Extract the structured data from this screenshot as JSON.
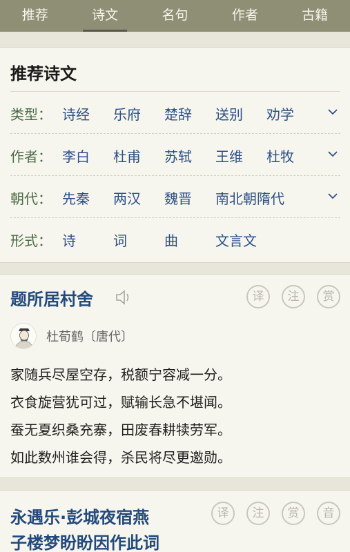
{
  "nav": {
    "tabs": [
      "推荐",
      "诗文",
      "名句",
      "作者",
      "古籍"
    ],
    "active_index": 1
  },
  "recommend": {
    "title": "推荐诗文",
    "filters": [
      {
        "label": "类型：",
        "options": [
          "诗经",
          "乐府",
          "楚辞",
          "送别",
          "劝学"
        ],
        "expandable": true
      },
      {
        "label": "作者：",
        "options": [
          "李白",
          "杜甫",
          "苏轼",
          "王维",
          "杜牧"
        ],
        "expandable": true
      },
      {
        "label": "朝代：",
        "options": [
          "先秦",
          "两汉",
          "魏晋",
          "南北朝隋代"
        ],
        "expandable": true
      },
      {
        "label": "形式：",
        "options": [
          "诗",
          "词",
          "曲",
          "文言文"
        ],
        "expandable": false
      }
    ]
  },
  "poems": [
    {
      "title": "题所居村舍",
      "author": "杜荀鹤〔唐代〕",
      "actions": [
        "译",
        "注",
        "赏"
      ],
      "lines": [
        "家随兵尽屋空存，税额宁容减一分。",
        "衣食旋营犹可过，赋输长急不堪闻。",
        "蚕无夏织桑充寨，田废春耕犊劳军。",
        "如此数州谁会得，杀民将尽更邀勋。"
      ]
    },
    {
      "title_lines": [
        "永遇乐·彭城夜宿燕",
        "子楼梦盼盼因作此词"
      ],
      "actions": [
        "译",
        "注",
        "赏",
        "音"
      ]
    }
  ],
  "icons": {
    "speaker": "speaker-icon",
    "chevron": "chevron-down-icon",
    "avatar": "author-avatar"
  },
  "colors": {
    "nav_bg": "#8e8f75",
    "page_bg": "#e8e6da",
    "card_bg": "#f7f6ee",
    "label_green": "#4b6b46",
    "link_blue": "#2c4f86",
    "title_blue": "#234a7c"
  }
}
